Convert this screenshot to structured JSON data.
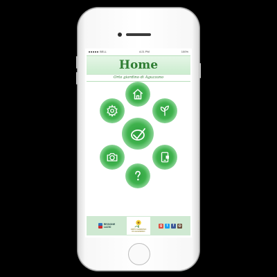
{
  "status_bar": {
    "carrier": "BELL",
    "time": "4:21 PM",
    "battery": "100%"
  },
  "header": {
    "title": "Home",
    "subtitle": "Orto giardino di Aguzzano"
  },
  "menu": {
    "home": "home-icon",
    "settings": "gear-icon",
    "plants": "leaf-icon",
    "main": "checkmark-icon",
    "camera": "camera-icon",
    "device": "mobile-icon",
    "help": "question-icon"
  },
  "footer": {
    "left_text_1": "REGIONE",
    "left_text_2": "LAZIO",
    "center_caption_1": "ORTO GIARDINO",
    "center_caption_2": "DI AGUZZANO",
    "social": [
      "google-plus-icon",
      "twitter-icon",
      "facebook-icon",
      "instagram-icon"
    ]
  },
  "colors": {
    "accent": "#2e7d32",
    "header_bg": "#d3efd6",
    "button_green": "#3fb24d",
    "footer_bg": "#cfe9d2"
  }
}
